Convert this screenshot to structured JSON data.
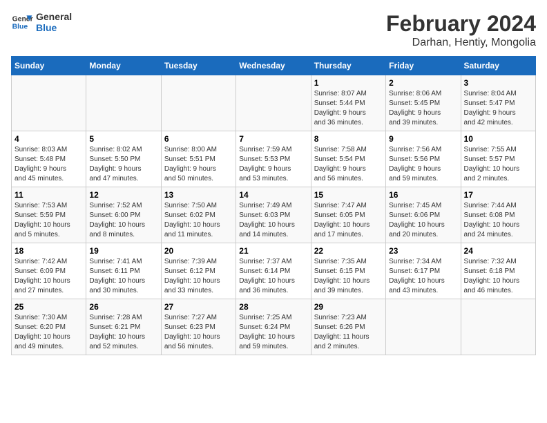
{
  "header": {
    "logo_line1": "General",
    "logo_line2": "Blue",
    "title": "February 2024",
    "subtitle": "Darhan, Hentiy, Mongolia"
  },
  "weekdays": [
    "Sunday",
    "Monday",
    "Tuesday",
    "Wednesday",
    "Thursday",
    "Friday",
    "Saturday"
  ],
  "weeks": [
    [
      {
        "day": "",
        "info": ""
      },
      {
        "day": "",
        "info": ""
      },
      {
        "day": "",
        "info": ""
      },
      {
        "day": "",
        "info": ""
      },
      {
        "day": "1",
        "info": "Sunrise: 8:07 AM\nSunset: 5:44 PM\nDaylight: 9 hours\nand 36 minutes."
      },
      {
        "day": "2",
        "info": "Sunrise: 8:06 AM\nSunset: 5:45 PM\nDaylight: 9 hours\nand 39 minutes."
      },
      {
        "day": "3",
        "info": "Sunrise: 8:04 AM\nSunset: 5:47 PM\nDaylight: 9 hours\nand 42 minutes."
      }
    ],
    [
      {
        "day": "4",
        "info": "Sunrise: 8:03 AM\nSunset: 5:48 PM\nDaylight: 9 hours\nand 45 minutes."
      },
      {
        "day": "5",
        "info": "Sunrise: 8:02 AM\nSunset: 5:50 PM\nDaylight: 9 hours\nand 47 minutes."
      },
      {
        "day": "6",
        "info": "Sunrise: 8:00 AM\nSunset: 5:51 PM\nDaylight: 9 hours\nand 50 minutes."
      },
      {
        "day": "7",
        "info": "Sunrise: 7:59 AM\nSunset: 5:53 PM\nDaylight: 9 hours\nand 53 minutes."
      },
      {
        "day": "8",
        "info": "Sunrise: 7:58 AM\nSunset: 5:54 PM\nDaylight: 9 hours\nand 56 minutes."
      },
      {
        "day": "9",
        "info": "Sunrise: 7:56 AM\nSunset: 5:56 PM\nDaylight: 9 hours\nand 59 minutes."
      },
      {
        "day": "10",
        "info": "Sunrise: 7:55 AM\nSunset: 5:57 PM\nDaylight: 10 hours\nand 2 minutes."
      }
    ],
    [
      {
        "day": "11",
        "info": "Sunrise: 7:53 AM\nSunset: 5:59 PM\nDaylight: 10 hours\nand 5 minutes."
      },
      {
        "day": "12",
        "info": "Sunrise: 7:52 AM\nSunset: 6:00 PM\nDaylight: 10 hours\nand 8 minutes."
      },
      {
        "day": "13",
        "info": "Sunrise: 7:50 AM\nSunset: 6:02 PM\nDaylight: 10 hours\nand 11 minutes."
      },
      {
        "day": "14",
        "info": "Sunrise: 7:49 AM\nSunset: 6:03 PM\nDaylight: 10 hours\nand 14 minutes."
      },
      {
        "day": "15",
        "info": "Sunrise: 7:47 AM\nSunset: 6:05 PM\nDaylight: 10 hours\nand 17 minutes."
      },
      {
        "day": "16",
        "info": "Sunrise: 7:45 AM\nSunset: 6:06 PM\nDaylight: 10 hours\nand 20 minutes."
      },
      {
        "day": "17",
        "info": "Sunrise: 7:44 AM\nSunset: 6:08 PM\nDaylight: 10 hours\nand 24 minutes."
      }
    ],
    [
      {
        "day": "18",
        "info": "Sunrise: 7:42 AM\nSunset: 6:09 PM\nDaylight: 10 hours\nand 27 minutes."
      },
      {
        "day": "19",
        "info": "Sunrise: 7:41 AM\nSunset: 6:11 PM\nDaylight: 10 hours\nand 30 minutes."
      },
      {
        "day": "20",
        "info": "Sunrise: 7:39 AM\nSunset: 6:12 PM\nDaylight: 10 hours\nand 33 minutes."
      },
      {
        "day": "21",
        "info": "Sunrise: 7:37 AM\nSunset: 6:14 PM\nDaylight: 10 hours\nand 36 minutes."
      },
      {
        "day": "22",
        "info": "Sunrise: 7:35 AM\nSunset: 6:15 PM\nDaylight: 10 hours\nand 39 minutes."
      },
      {
        "day": "23",
        "info": "Sunrise: 7:34 AM\nSunset: 6:17 PM\nDaylight: 10 hours\nand 43 minutes."
      },
      {
        "day": "24",
        "info": "Sunrise: 7:32 AM\nSunset: 6:18 PM\nDaylight: 10 hours\nand 46 minutes."
      }
    ],
    [
      {
        "day": "25",
        "info": "Sunrise: 7:30 AM\nSunset: 6:20 PM\nDaylight: 10 hours\nand 49 minutes."
      },
      {
        "day": "26",
        "info": "Sunrise: 7:28 AM\nSunset: 6:21 PM\nDaylight: 10 hours\nand 52 minutes."
      },
      {
        "day": "27",
        "info": "Sunrise: 7:27 AM\nSunset: 6:23 PM\nDaylight: 10 hours\nand 56 minutes."
      },
      {
        "day": "28",
        "info": "Sunrise: 7:25 AM\nSunset: 6:24 PM\nDaylight: 10 hours\nand 59 minutes."
      },
      {
        "day": "29",
        "info": "Sunrise: 7:23 AM\nSunset: 6:26 PM\nDaylight: 11 hours\nand 2 minutes."
      },
      {
        "day": "",
        "info": ""
      },
      {
        "day": "",
        "info": ""
      }
    ]
  ]
}
